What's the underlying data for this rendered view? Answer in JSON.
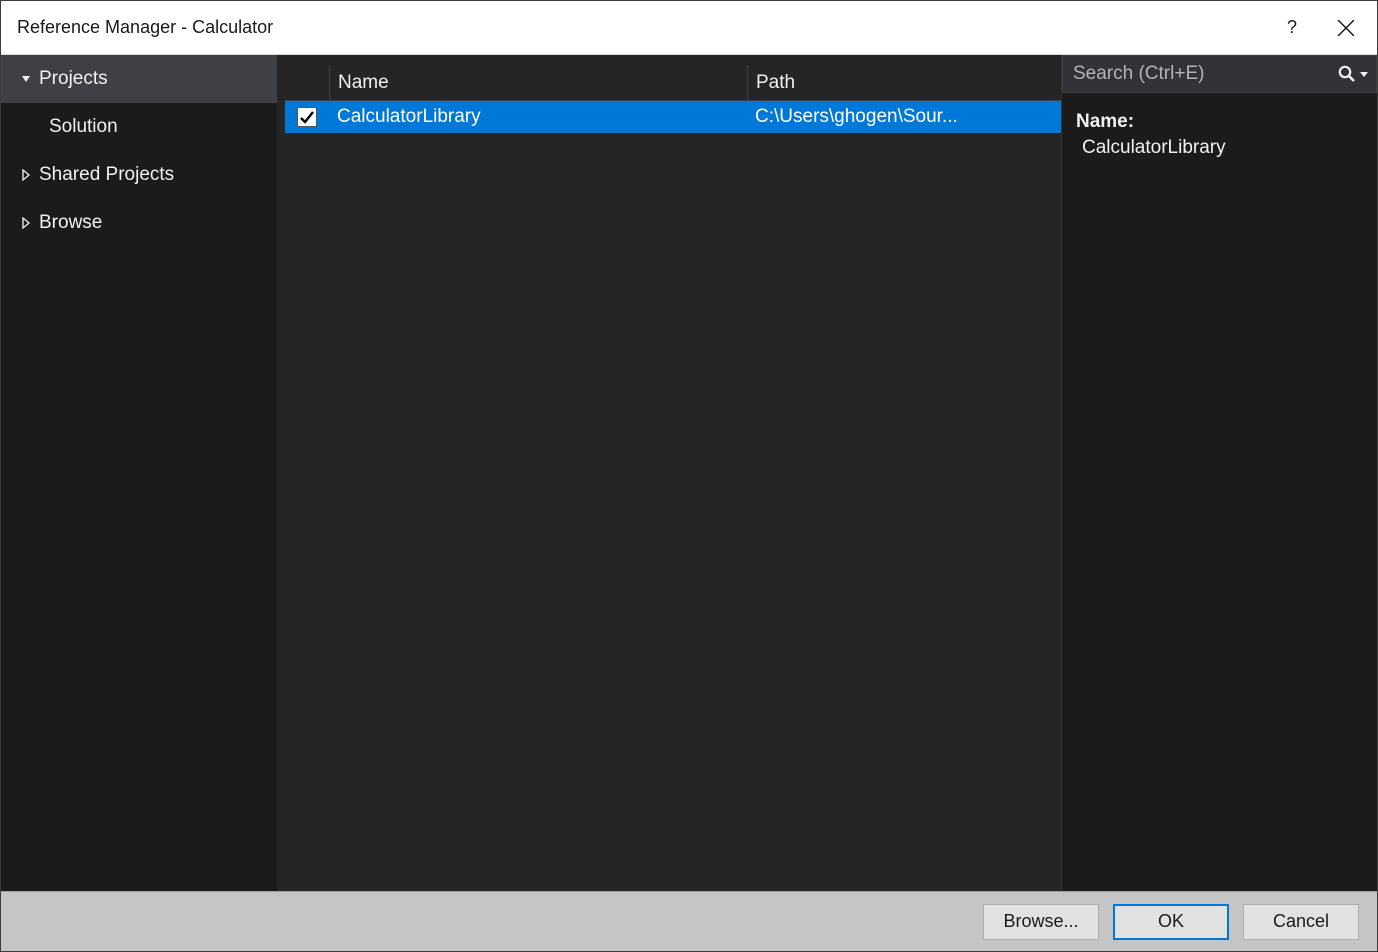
{
  "titlebar": {
    "title": "Reference Manager - Calculator",
    "help": "?"
  },
  "sidebar": {
    "items": [
      {
        "label": "Projects",
        "expanded": true,
        "selected": true
      },
      {
        "label": "Shared Projects",
        "expanded": false,
        "selected": false
      },
      {
        "label": "Browse",
        "expanded": false,
        "selected": false
      }
    ],
    "subitems": [
      {
        "label": "Solution"
      }
    ]
  },
  "table": {
    "headers": {
      "name": "Name",
      "path": "Path"
    },
    "rows": [
      {
        "checked": true,
        "name": "CalculatorLibrary",
        "path": "C:\\Users\\ghogen\\Sour..."
      }
    ]
  },
  "search": {
    "placeholder": "Search (Ctrl+E)",
    "value": ""
  },
  "details": {
    "name_label": "Name:",
    "name_value": "CalculatorLibrary"
  },
  "footer": {
    "browse": "Browse...",
    "ok": "OK",
    "cancel": "Cancel"
  }
}
